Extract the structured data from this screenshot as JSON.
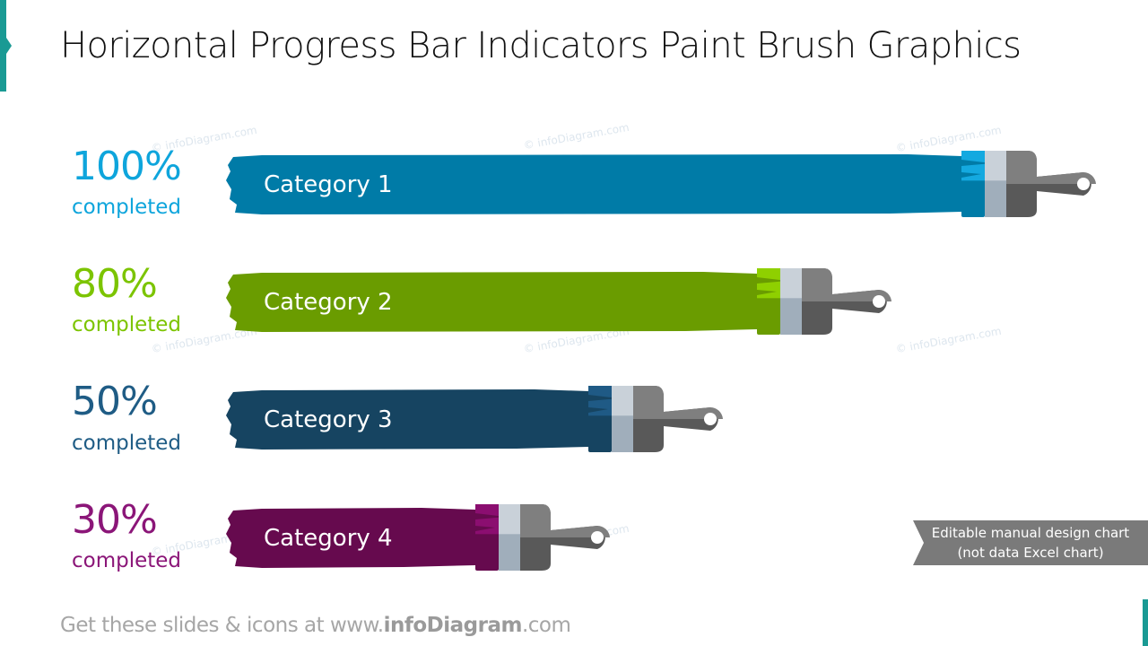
{
  "title": "Horizontal Progress Bar Indicators Paint Brush Graphics",
  "watermark": "© infoDiagram.com",
  "note": {
    "line1": "Editable manual design chart",
    "line2": "(not data Excel chart)"
  },
  "footer": {
    "prefix": "Get these slides & icons at www.",
    "brand": "infoDiagram",
    "suffix": ".com"
  },
  "colors": {
    "accent": "#1a9a94",
    "brush_light": "#c9d1d9",
    "brush_mid": "#a0aebb",
    "handle_light": "#7f7f7f",
    "handle_dark": "#595959"
  },
  "chart_data": {
    "type": "bar",
    "orientation": "horizontal",
    "title": "Horizontal Progress Bar Indicators Paint Brush Graphics",
    "categories": [
      "Category 1",
      "Category 2",
      "Category 3",
      "Category 4"
    ],
    "values": [
      100,
      80,
      50,
      30
    ],
    "unit": "%",
    "value_labels": [
      "100%",
      "80%",
      "50%",
      "30%"
    ],
    "sub_label": "completed",
    "xlim": [
      0,
      100
    ],
    "grid": false,
    "legend": "none",
    "series_colors": [
      "#007ba7",
      "#6a9c00",
      "#164461",
      "#660a4e"
    ],
    "label_colors": [
      "#0ea5dc",
      "#7cc400",
      "#1f5c85",
      "#8b1678"
    ],
    "tip_colors": [
      "#14a9e0",
      "#8fd000",
      "#1f5a85",
      "#8b0e70"
    ]
  }
}
